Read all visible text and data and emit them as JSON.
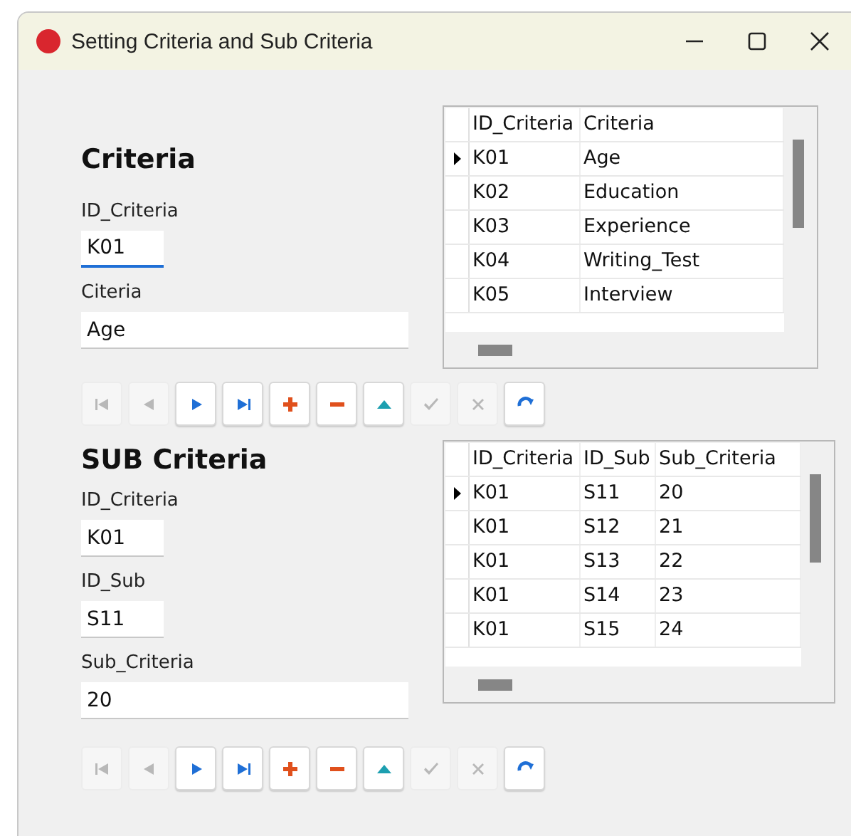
{
  "window": {
    "title": "Setting Criteria and Sub Criteria"
  },
  "sections": [
    {
      "heading": "Criteria",
      "fields": [
        {
          "label": "ID_Criteria",
          "value": "K01",
          "focused": true
        },
        {
          "label": "Citeria",
          "value": "Age",
          "focused": false
        }
      ],
      "table": {
        "columns": [
          "ID_Criteria",
          "Criteria"
        ],
        "rows": [
          {
            "cells": [
              "K01",
              "Age"
            ],
            "selected": true
          },
          {
            "cells": [
              "K02",
              "Education"
            ],
            "selected": false
          },
          {
            "cells": [
              "K03",
              "Experience"
            ],
            "selected": false
          },
          {
            "cells": [
              "K04",
              "Writing_Test"
            ],
            "selected": false
          },
          {
            "cells": [
              "K05",
              "Interview"
            ],
            "selected": false
          }
        ]
      },
      "navigator": [
        {
          "kind": "first",
          "disabled": true
        },
        {
          "kind": "prior",
          "disabled": true
        },
        {
          "kind": "next",
          "disabled": false
        },
        {
          "kind": "last",
          "disabled": false
        },
        {
          "kind": "insert",
          "disabled": false
        },
        {
          "kind": "delete",
          "disabled": false
        },
        {
          "kind": "edit",
          "disabled": false
        },
        {
          "kind": "post",
          "disabled": true
        },
        {
          "kind": "cancel",
          "disabled": true
        },
        {
          "kind": "refresh",
          "disabled": false
        }
      ]
    },
    {
      "heading": "SUB Criteria",
      "fields": [
        {
          "label": "ID_Criteria",
          "value": "K01",
          "focused": false
        },
        {
          "label": "ID_Sub",
          "value": "S11",
          "focused": false
        },
        {
          "label": "Sub_Criteria",
          "value": "20",
          "focused": false
        }
      ],
      "table": {
        "columns": [
          "ID_Criteria",
          "ID_Sub",
          "Sub_Criteria"
        ],
        "rows": [
          {
            "cells": [
              "K01",
              "S11",
              "20"
            ],
            "selected": true
          },
          {
            "cells": [
              "K01",
              "S12",
              "21"
            ],
            "selected": false
          },
          {
            "cells": [
              "K01",
              "S13",
              "22"
            ],
            "selected": false
          },
          {
            "cells": [
              "K01",
              "S14",
              "23"
            ],
            "selected": false
          },
          {
            "cells": [
              "K01",
              "S15",
              "24"
            ],
            "selected": false
          }
        ]
      },
      "navigator": [
        {
          "kind": "first",
          "disabled": true
        },
        {
          "kind": "prior",
          "disabled": true
        },
        {
          "kind": "next",
          "disabled": false
        },
        {
          "kind": "last",
          "disabled": false
        },
        {
          "kind": "insert",
          "disabled": false
        },
        {
          "kind": "delete",
          "disabled": false
        },
        {
          "kind": "edit",
          "disabled": false
        },
        {
          "kind": "post",
          "disabled": true
        },
        {
          "kind": "cancel",
          "disabled": true
        },
        {
          "kind": "refresh",
          "disabled": false
        }
      ]
    }
  ]
}
